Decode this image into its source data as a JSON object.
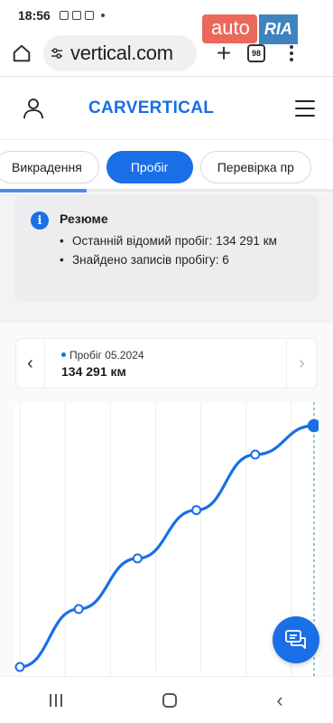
{
  "status_bar": {
    "time": "18:56"
  },
  "browser": {
    "url": "vertical.com",
    "tab_count": "98"
  },
  "watermark": {
    "part1": "auto",
    "part2": "RIA"
  },
  "site": {
    "logo": "CARVERTICAL"
  },
  "tabs": [
    {
      "label": "Викрадення",
      "active": false
    },
    {
      "label": "Пробіг",
      "active": true
    },
    {
      "label": "Перевірка пр",
      "active": false
    }
  ],
  "tabs_scroll_progress": 0.26,
  "summary": {
    "title": "Резюме",
    "items": [
      "Останній відомий пробіг: 134 291 км",
      "Знайдено записів пробігу: 6"
    ]
  },
  "mileage_nav": {
    "label": "Пробіг 05.2024",
    "value": "134 291 км"
  },
  "colors": {
    "accent": "#1a6ee6",
    "line": "#1a6ee6"
  },
  "icons": {
    "home": "home-icon",
    "tune": "tune-icon",
    "user": "user-icon",
    "menu": "hamburger-icon",
    "info": "info-icon",
    "prev": "chevron-left-icon",
    "next": "chevron-right-icon",
    "chat": "chat-icon"
  },
  "chart_data": {
    "type": "line",
    "series": [
      {
        "values": [
          0,
          0.24,
          0.45,
          0.65,
          0.88,
          1.0
        ]
      }
    ],
    "x": [
      0,
      1,
      2,
      3,
      4,
      5
    ],
    "ylim": [
      0,
      1
    ],
    "grid": true,
    "title": "",
    "xlabel": "",
    "ylabel": ""
  }
}
